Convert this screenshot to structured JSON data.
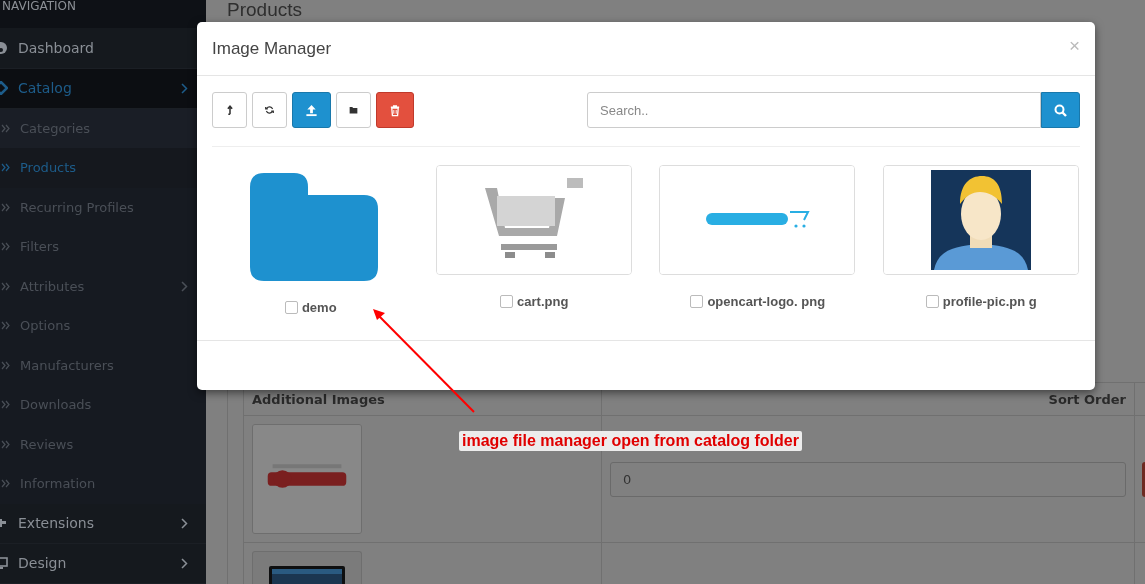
{
  "sidebar": {
    "heading": "NAVIGATION",
    "items": [
      {
        "label": "Dashboard",
        "active": false,
        "has_submenu": false
      },
      {
        "label": "Catalog",
        "active": true,
        "has_submenu": true,
        "expanded": true,
        "children": [
          {
            "label": "Categories",
            "active": false,
            "has_submenu": false
          },
          {
            "label": "Products",
            "active": true,
            "has_submenu": false
          },
          {
            "label": "Recurring Profiles",
            "active": false,
            "has_submenu": false
          },
          {
            "label": "Filters",
            "active": false,
            "has_submenu": false
          },
          {
            "label": "Attributes",
            "active": false,
            "has_submenu": true
          },
          {
            "label": "Options",
            "active": false,
            "has_submenu": false
          },
          {
            "label": "Manufacturers",
            "active": false,
            "has_submenu": false
          },
          {
            "label": "Downloads",
            "active": false,
            "has_submenu": false
          },
          {
            "label": "Reviews",
            "active": false,
            "has_submenu": false
          },
          {
            "label": "Information",
            "active": false,
            "has_submenu": false
          }
        ]
      },
      {
        "label": "Extensions",
        "active": false,
        "has_submenu": true
      },
      {
        "label": "Design",
        "active": false,
        "has_submenu": true
      }
    ]
  },
  "page": {
    "title": "Products",
    "table": {
      "columns": [
        "Additional Images",
        "Sort Order"
      ],
      "rows": [
        {
          "image": {
            "kind": "picture"
          },
          "sort_order": "0"
        },
        {
          "image": {
            "kind": "picture"
          }
        }
      ]
    }
  },
  "modal": {
    "title": "Image Manager",
    "close": "×",
    "toolbar": [
      {
        "kind": "parent"
      },
      {
        "kind": "refresh"
      },
      {
        "kind": "upload"
      },
      {
        "kind": "folder"
      },
      {
        "kind": "delete"
      }
    ],
    "search": {
      "placeholder": "Search.."
    },
    "files": [
      {
        "kind": "folder",
        "name": "demo",
        "checked": false
      },
      {
        "name": "cart.png",
        "checked": false
      },
      {
        "name": "opencart-logo. png",
        "checked": false
      },
      {
        "name": "profile-pic.pn g",
        "checked": false
      }
    ]
  },
  "annotation": {
    "text": "image file manager open from catalog folder"
  }
}
